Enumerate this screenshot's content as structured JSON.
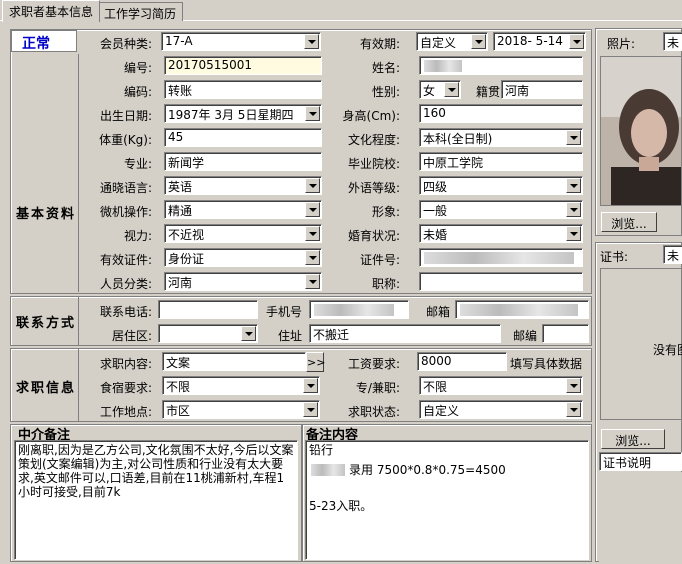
{
  "tabs": [
    "求职者基本信息",
    "工作学习简历"
  ],
  "status": "正常",
  "sections": {
    "basic": "基本资料",
    "contact": "联系方式",
    "job": "求职信息"
  },
  "labels": {
    "member_type": "会员种类:",
    "valid_period": "有效期:",
    "number": "编号:",
    "name": "姓名:",
    "code": "编码:",
    "gender": "性别:",
    "native": "籍贯",
    "birth": "出生日期:",
    "height": "身高(Cm):",
    "weight": "体重(Kg):",
    "education": "文化程度:",
    "major": "专业:",
    "school": "毕业院校:",
    "language": "通晓语言:",
    "lang_level": "外语等级:",
    "computer": "微机操作:",
    "appearance": "形象:",
    "vision": "视力:",
    "marital": "婚育状况:",
    "id_doc": "有效证件:",
    "id_no": "证件号:",
    "person_type": "人员分类:",
    "title": "职称:",
    "phone": "联系电话:",
    "mobile": "手机号",
    "email": "邮箱",
    "residence": "居住区:",
    "address": "住址",
    "postcode": "邮编",
    "job_content": "求职内容:",
    "salary": "工资要求:",
    "salary_hint": "填写具体数据",
    "board": "食宿要求:",
    "fulltime": "专/兼职:",
    "location": "工作地点:",
    "job_status": "求职状态:",
    "photo": "照片:",
    "cert": "证书:"
  },
  "values": {
    "member_type": "17-A",
    "valid_type": "自定义",
    "valid_date": "2018- 5-14",
    "number": "20170515001",
    "code": "转账",
    "gender": "女",
    "native": "河南",
    "birth": "1987年 3月 5日星期四",
    "height": "160",
    "weight": "45",
    "education": "本科(全日制)",
    "major": "新闻学",
    "school": "中原工学院",
    "language": "英语",
    "lang_level": "四级",
    "computer": "精通",
    "appearance": "一般",
    "vision": "不近视",
    "marital": "未婚",
    "id_doc": "身份证",
    "person_type": "河南",
    "address": "不搬迁",
    "job_content": "文案",
    "salary": "8000",
    "board": "不限",
    "fulltime": "不限",
    "location": "市区",
    "job_status": "自定义",
    "photo_sel": "未",
    "cert_sel": "未",
    "job_more": ">>"
  },
  "notes": {
    "agent_title": "中介备注",
    "agent_text": "刚离职,因为是乙方公司,文化氛围不太好,今后以文案策划(文案编辑)为主,对公司性质和行业没有太大要求,英文邮件可以,口语差,目前在11桃浦新村,车程1小时可接受,目前7k",
    "remark_title": "备注内容",
    "remark_line1": "铅行",
    "remark_line2": "录用 7500*0.8*0.75=4500",
    "remark_line3": "5-23入职。"
  },
  "buttons": {
    "browse": "浏览...",
    "cert_browse": "浏览..."
  },
  "cert_empty": "没有图",
  "cert_desc": "证书说明"
}
